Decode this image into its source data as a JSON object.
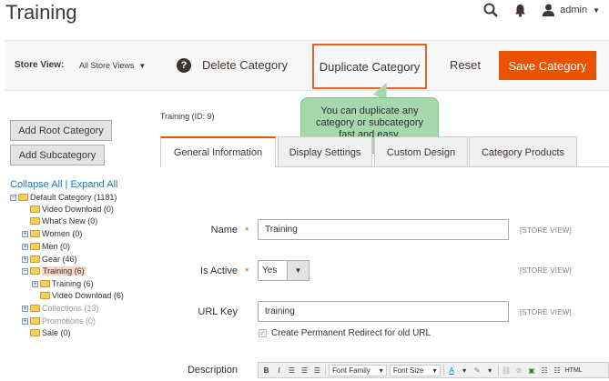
{
  "header": {
    "title": "Training",
    "user": "admin"
  },
  "actions": {
    "store_view_label": "Store View:",
    "store_view_value": "All Store Views",
    "delete": "Delete Category",
    "duplicate": "Duplicate Category",
    "reset": "Reset",
    "save": "Save Category"
  },
  "tooltip": "You can duplicate any category or subcategory fast and easy.",
  "sidebar": {
    "add_root": "Add Root Category",
    "add_sub": "Add Subcategory",
    "collapse_all": "Collapse All",
    "separator": "|",
    "expand_all": "Expand All",
    "tree": [
      {
        "label": "Default Category (1181)",
        "toggle": "−"
      },
      {
        "label": "Video Download (0)",
        "toggle": ""
      },
      {
        "label": "What's New (0)",
        "toggle": ""
      },
      {
        "label": "Women (0)",
        "toggle": "+"
      },
      {
        "label": "Men (0)",
        "toggle": "+"
      },
      {
        "label": "Gear (46)",
        "toggle": "+"
      },
      {
        "label": "Training (6)",
        "toggle": "−"
      },
      {
        "label": "Training (6)",
        "toggle": "+"
      },
      {
        "label": "Video Download (6)",
        "toggle": ""
      },
      {
        "label": "Collections (13)",
        "toggle": "+"
      },
      {
        "label": "Promotions (0)",
        "toggle": "+"
      },
      {
        "label": "Sale (0)",
        "toggle": ""
      }
    ]
  },
  "main": {
    "heading": "Training (ID: 9)",
    "tabs": [
      {
        "label": "General Information"
      },
      {
        "label": "Display Settings"
      },
      {
        "label": "Custom Design"
      },
      {
        "label": "Category Products"
      }
    ],
    "fields": {
      "name_label": "Name",
      "name_value": "Training",
      "active_label": "Is Active",
      "active_value": "Yes",
      "url_label": "URL Key",
      "url_value": "training",
      "redirect_label": "Create Permanent Redirect for old URL",
      "description_label": "Description",
      "scope": "[STORE VIEW]",
      "required_mark": "*"
    },
    "editor": {
      "bold": "B",
      "italic": "I",
      "font_family": "Font Family",
      "font_size": "Font Size",
      "html": "HTML"
    }
  },
  "colors": {
    "accent": "#eb5202",
    "highlight_border": "#e8632a",
    "tooltip_bg": "#a6d8ae",
    "link": "#1979c3"
  }
}
